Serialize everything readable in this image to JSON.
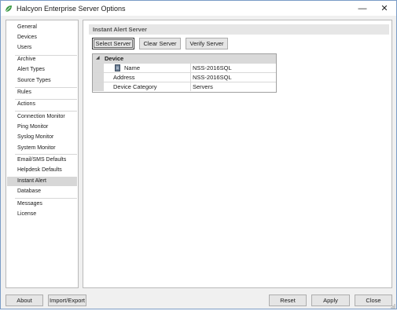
{
  "window": {
    "title": "Halcyon Enterprise Server Options",
    "minimize_glyph": "—",
    "close_glyph": "✕",
    "icon": "halcyon-leaf-icon",
    "accent": "#3f9b48"
  },
  "sidebar": {
    "selected": "Instant Alert",
    "items": [
      {
        "label": "General"
      },
      {
        "label": "Devices"
      },
      {
        "label": "Users"
      },
      {
        "label": "Archive"
      },
      {
        "label": "Alert Types"
      },
      {
        "label": "Source Types"
      },
      {
        "label": "Rules"
      },
      {
        "label": "Actions"
      },
      {
        "label": "Connection Monitor"
      },
      {
        "label": "Ping Monitor"
      },
      {
        "label": "Syslog Monitor"
      },
      {
        "label": "System Monitor"
      },
      {
        "label": "Email/SMS Defaults"
      },
      {
        "label": "Helpdesk Defaults"
      },
      {
        "label": "Instant Alert"
      },
      {
        "label": "Database"
      },
      {
        "label": "Messages"
      },
      {
        "label": "License"
      }
    ]
  },
  "main": {
    "section_title": "Instant Alert Server",
    "buttons": {
      "select_server": "Select Server",
      "clear_server": "Clear Server",
      "verify_server": "Verify Server"
    },
    "property_grid": {
      "category": "Device",
      "collapse_glyph": "◢",
      "rows": [
        {
          "name": "Name",
          "value": "NSS-2016SQL",
          "icon": "server-icon"
        },
        {
          "name": "Address",
          "value": "NSS-2016SQL"
        },
        {
          "name": "Device Category",
          "value": "Servers"
        }
      ]
    }
  },
  "footer": {
    "about": "About",
    "import_export": "Import/Export",
    "reset": "Reset",
    "apply": "Apply",
    "close": "Close"
  }
}
